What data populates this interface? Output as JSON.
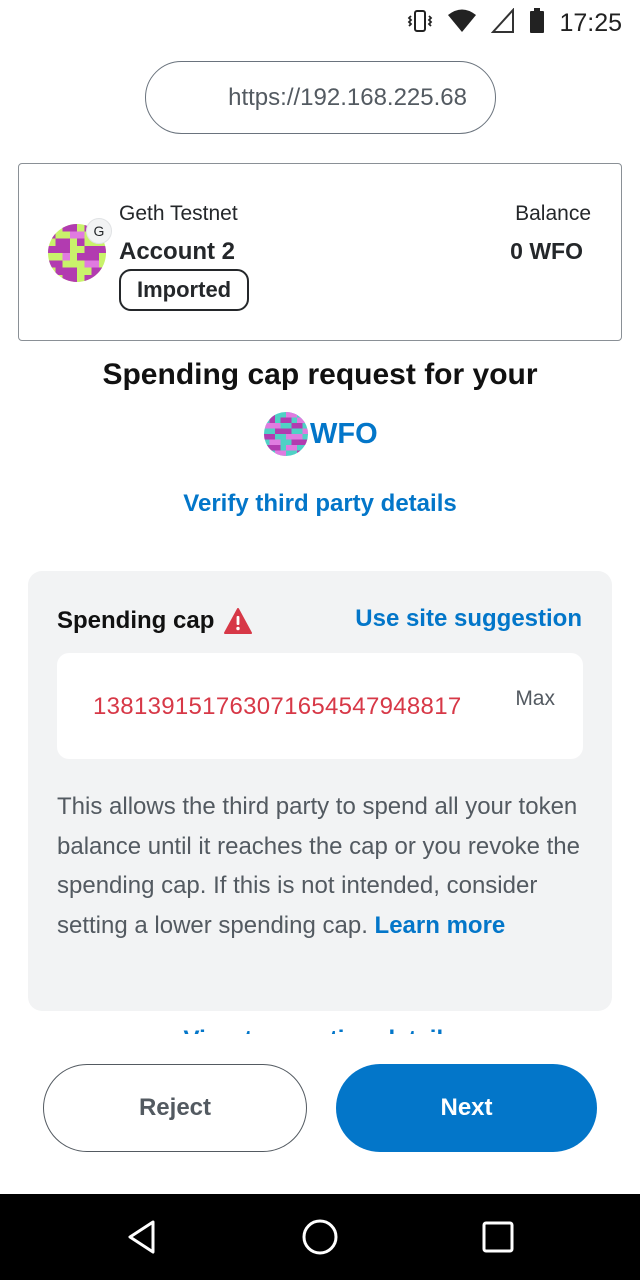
{
  "status_bar": {
    "time": "17:25",
    "icons": [
      "vibrate-icon",
      "wifi-icon",
      "cellular-signal-icon",
      "battery-icon"
    ]
  },
  "browser": {
    "url": "https://192.168.225.68"
  },
  "account": {
    "network": "Geth Testnet",
    "name": "Account 2",
    "avatar_badge": "G",
    "tag": "Imported",
    "balance_label": "Balance",
    "balance_value": "0 WFO"
  },
  "request": {
    "title": "Spending cap request for your",
    "token": "WFO",
    "verify_link": "Verify third party details"
  },
  "spending_cap": {
    "label": "Spending cap",
    "use_site_suggestion": "Use site suggestion",
    "value": "13813915176307165454794881​7",
    "max_label": "Max",
    "description": "This allows the third party to spend all your token balance until it reaches the cap or you revoke the spending cap. If this is not intended, consider setting a lower spending cap.",
    "learn_more": "Learn more"
  },
  "actions": {
    "reject": "Reject",
    "next": "Next",
    "view_details": "View transaction details"
  },
  "colors": {
    "primary": "#0376c9",
    "error": "#d73847",
    "panel_bg": "#f2f3f4",
    "text_muted": "#535a61"
  }
}
